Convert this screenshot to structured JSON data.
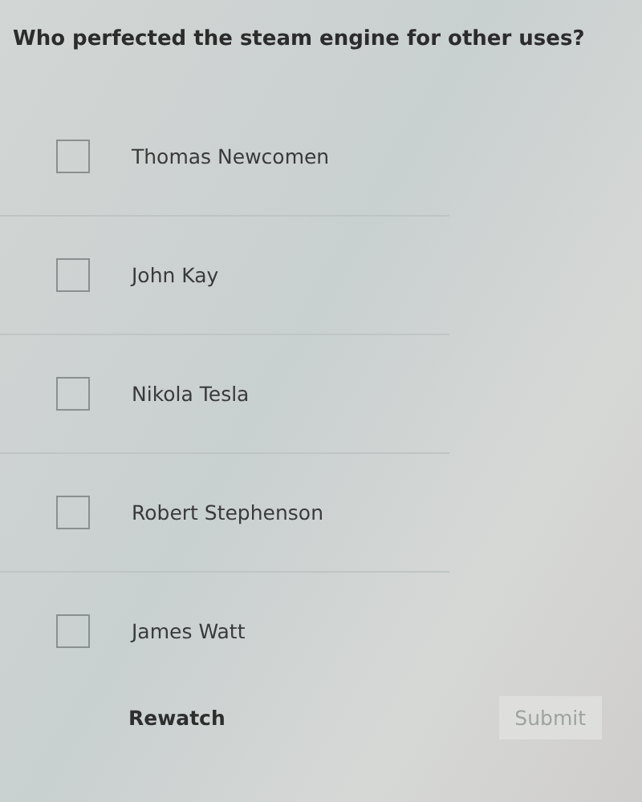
{
  "question": "Who perfected the steam engine for other uses?",
  "options": [
    {
      "label": "Thomas Newcomen",
      "checked": false
    },
    {
      "label": "John Kay",
      "checked": false
    },
    {
      "label": "Nikola Tesla",
      "checked": false
    },
    {
      "label": "Robert Stephenson",
      "checked": false
    },
    {
      "label": "James Watt",
      "checked": false
    }
  ],
  "actions": {
    "rewatch": "Rewatch",
    "submit": {
      "label": "Submit",
      "disabled": true
    }
  }
}
